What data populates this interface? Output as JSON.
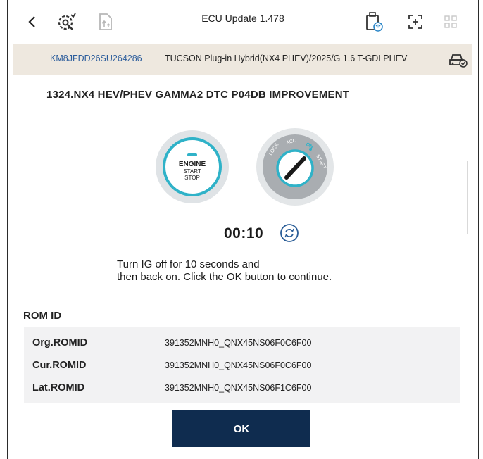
{
  "header": {
    "title": "ECU Update 1.478",
    "icons": [
      "back-chevron-icon",
      "settings-wrench-icon",
      "upload-doc-icon",
      "connection-icon",
      "expand-icon",
      "grid-icon"
    ]
  },
  "vehicle": {
    "vin": "KM8JFDD26SU264286",
    "model": "TUCSON Plug-in Hybrid(NX4 PHEV)/2025/G 1.6 T-GDI PHEV"
  },
  "procedure": {
    "heading": "1324.NX4 HEV/PHEV GAMMA2 DTC P04DB IMPROVEMENT",
    "engine_button": {
      "line1": "ENGINE",
      "line2": "START",
      "line3": "STOP"
    },
    "ignition_positions": [
      "LOCK",
      "ACC",
      "ON",
      "START"
    ],
    "timer": "00:10",
    "instruction_line1": "Turn IG off for 10 seconds and",
    "instruction_line2": "then back on. Click the OK button to continue."
  },
  "rom": {
    "heading": "ROM ID",
    "rows": [
      {
        "label": "Org.ROMID",
        "value": "391352MNH0_QNX45NS06F0C6F00"
      },
      {
        "label": "Cur.ROMID",
        "value": "391352MNH0_QNX45NS06F0C6F00"
      },
      {
        "label": "Lat.ROMID",
        "value": "391352MNH0_QNX45NS06F1C6F00"
      }
    ]
  },
  "ok_label": "OK",
  "colors": {
    "accent": "#2fb2c8",
    "primary_button": "#0f2c4f",
    "vin_text": "#2c5d9c",
    "vin_bar": "#eee8df"
  }
}
